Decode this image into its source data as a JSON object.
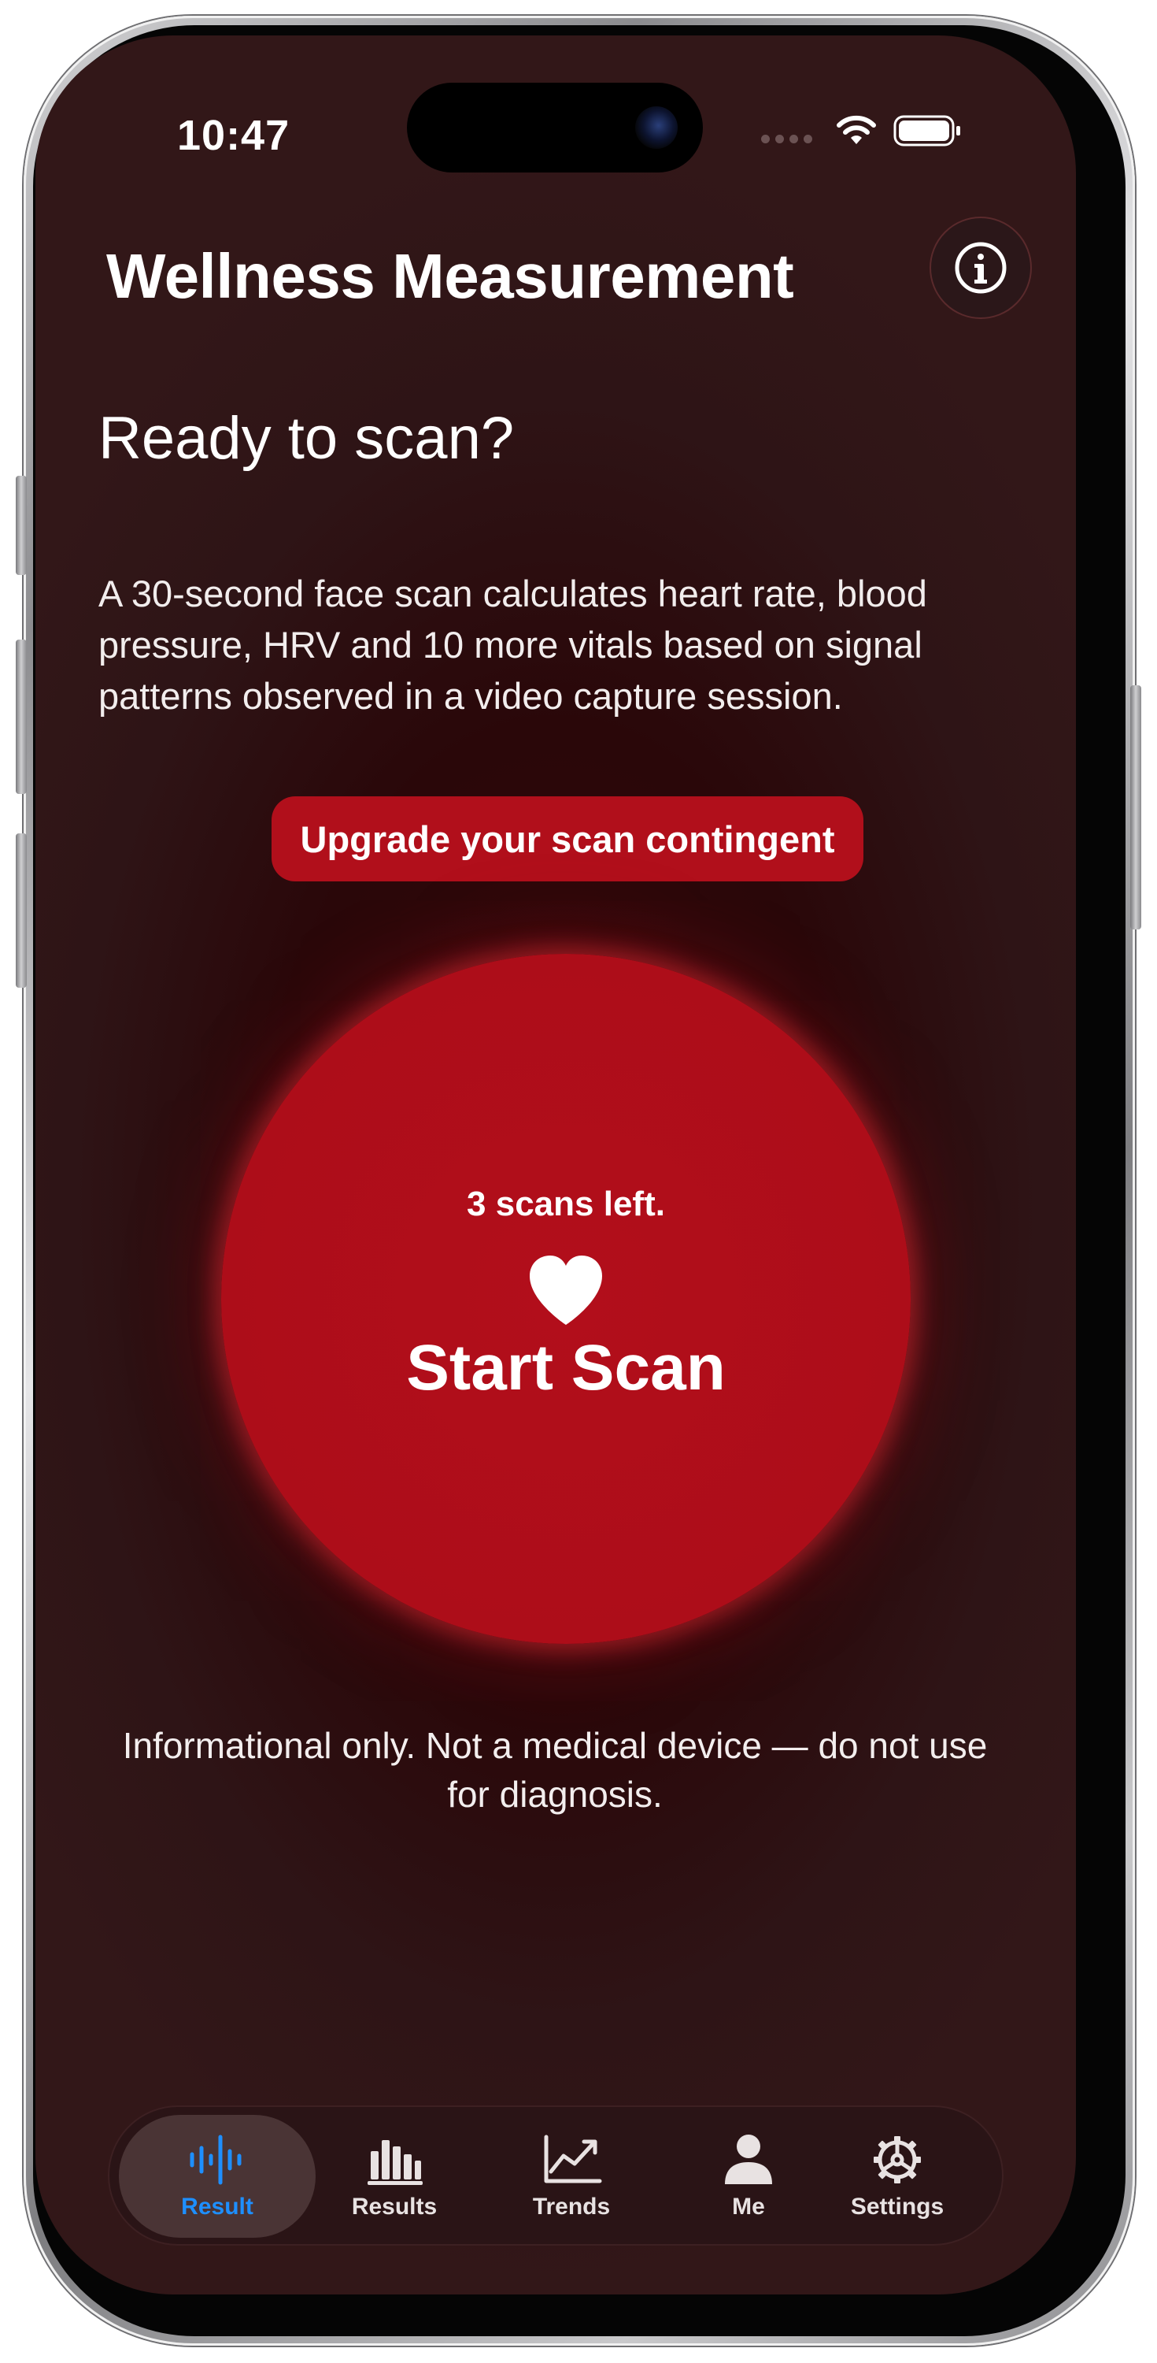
{
  "status_bar": {
    "time": "10:47"
  },
  "header": {
    "title": "Wellness Measurement",
    "info_icon": "info-icon"
  },
  "main": {
    "headline": "Ready to scan?",
    "description": "A 30-second face scan calculates heart rate, blood pressure, HRV and 10 more vitals based on signal patterns observed in a video capture session.",
    "upgrade_label": "Upgrade your scan contingent",
    "scan_button": {
      "scans_left": "3 scans left.",
      "icon": "heart-icon",
      "label": "Start Scan"
    },
    "disclaimer": "Informational only. Not a medical device — do not use for diagnosis."
  },
  "tab_bar": {
    "tabs": [
      {
        "label": "Result",
        "icon": "waveform-icon",
        "active": true
      },
      {
        "label": "Results",
        "icon": "bar-chart-icon",
        "active": false
      },
      {
        "label": "Trends",
        "icon": "trend-chart-icon",
        "active": false
      },
      {
        "label": "Me",
        "icon": "person-icon",
        "active": false
      },
      {
        "label": "Settings",
        "icon": "gear-icon",
        "active": false
      }
    ]
  },
  "colors": {
    "accent": "#b10f1b",
    "active_tab": "#1e8fff",
    "background": "#2e1416"
  }
}
